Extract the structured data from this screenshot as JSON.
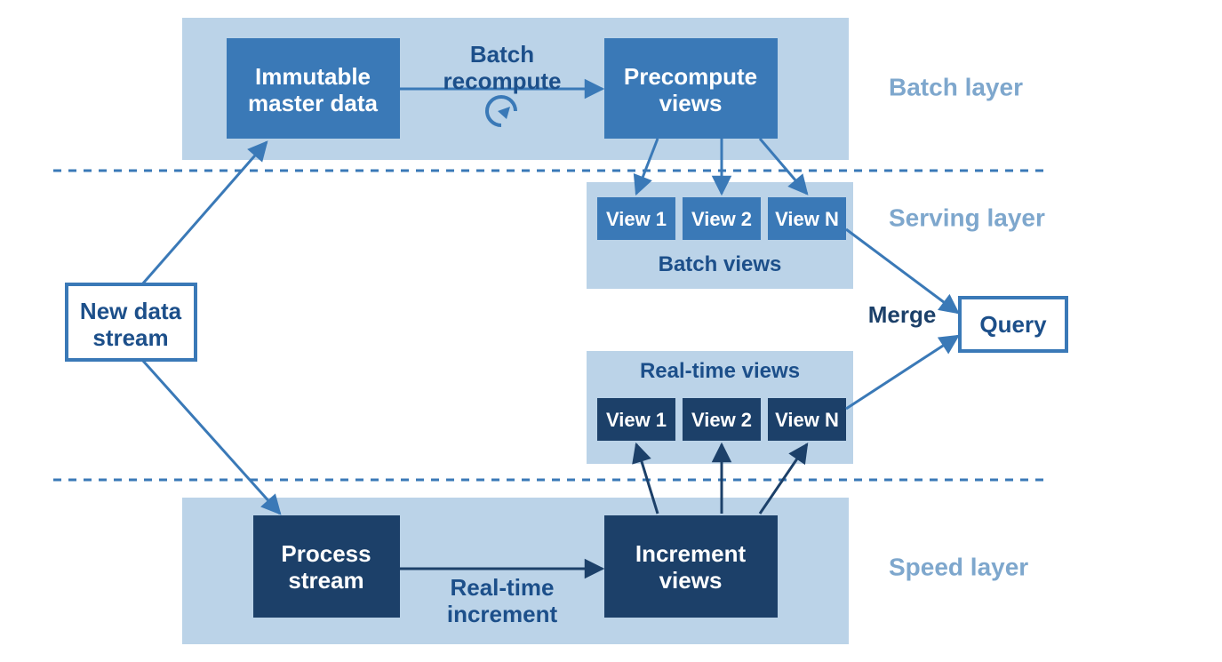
{
  "colors": {
    "bg": "#ffffff",
    "panel": "#bbd3e8",
    "mid": "#3a79b7",
    "dark": "#1c4069",
    "text_dark": "#1c4f8a",
    "text_light": "#ffffff",
    "layer_text": "#7ea7cd"
  },
  "layers": {
    "batch": "Batch layer",
    "serving": "Serving layer",
    "speed": "Speed layer"
  },
  "nodes": {
    "new_data_stream": {
      "l1": "New data",
      "l2": "stream"
    },
    "immutable_master": {
      "l1": "Immutable",
      "l2": "master data"
    },
    "precompute_views": {
      "l1": "Precompute",
      "l2": "views"
    },
    "process_stream": {
      "l1": "Process",
      "l2": "stream"
    },
    "increment_views": {
      "l1": "Increment",
      "l2": "views"
    },
    "query": "Query",
    "batch_views": [
      "View 1",
      "View 2",
      "View N"
    ],
    "rt_views": [
      "View 1",
      "View 2",
      "View N"
    ]
  },
  "edges": {
    "batch_recompute": {
      "l1": "Batch",
      "l2": "recompute"
    },
    "realtime_increment": {
      "l1": "Real-time",
      "l2": "increment"
    },
    "merge": "Merge"
  },
  "groups": {
    "batch_views_title": "Batch views",
    "rt_views_title": "Real-time views"
  }
}
